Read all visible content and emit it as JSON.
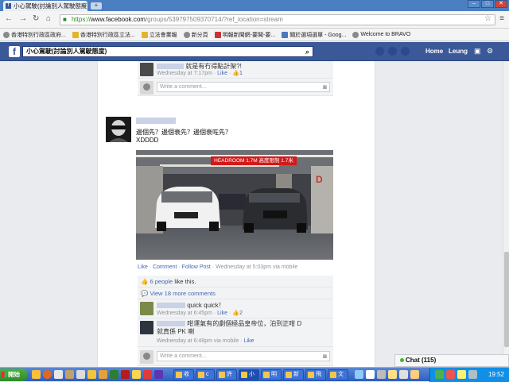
{
  "browser": {
    "tab_title": "小心駕駛(討論別人駕駛態度)",
    "url_scheme": "https://",
    "url_host": "www.facebook.com",
    "url_path": "/groups/539797509370714/?ref_location=stream"
  },
  "bookmarks": [
    "香港特別行政區政府...",
    "香港特別行政區立法...",
    "立法會業報",
    "新分頁",
    "明報新聞網-要聞-要...",
    "關於選項選單 - Goog...",
    "Welcome to BRAVO"
  ],
  "facebook": {
    "search_value": "小心駕駛(討論別人駕駛態度)",
    "nav_home": "Home",
    "nav_user": "Leung"
  },
  "prev_comment": {
    "text": "就是有冇得點計架?!",
    "time": "Wednesday at 7:17pm",
    "like": "Like",
    "likes_count": "1",
    "write_placeholder": "Write a comment..."
  },
  "post": {
    "line1": "邊個先？邊個衰先？邊個衰咗先？",
    "line2": "XDDDD",
    "photo_sign": "HEADROOM 1.7M 高度限制 1.7米",
    "photo_pillar_letter": "D",
    "actions": {
      "like": "Like",
      "comment": "Comment",
      "follow": "Follow Post",
      "time": "Wednesday at 5:03pm via mobile"
    },
    "likes_text": "6 people",
    "likes_suffix": "like this.",
    "view_more": "View 18 more comments"
  },
  "comments": [
    {
      "text": "quick quick！",
      "time": "Wednesday at 6:45pm",
      "like": "Like",
      "likes_count": "2"
    },
    {
      "text": "咁運氣有的劇個極品皇帝位，泊到正咁 D 就真係 PK 喇",
      "time": "Wednesday at 6:48pm via mobile",
      "like": "Like"
    }
  ],
  "write_comment_placeholder": "Write a comment...",
  "chat": {
    "label": "Chat (115)"
  },
  "taskbar": {
    "start_label": "開始",
    "tasks": [
      "收",
      "c",
      "許",
      "小",
      "明",
      "新",
      "飛",
      "文"
    ],
    "clock": "19:52"
  },
  "colors": {
    "facebook_blue": "#3b5998",
    "link": "#4267b2",
    "taskbar": "#2c5fc0"
  }
}
